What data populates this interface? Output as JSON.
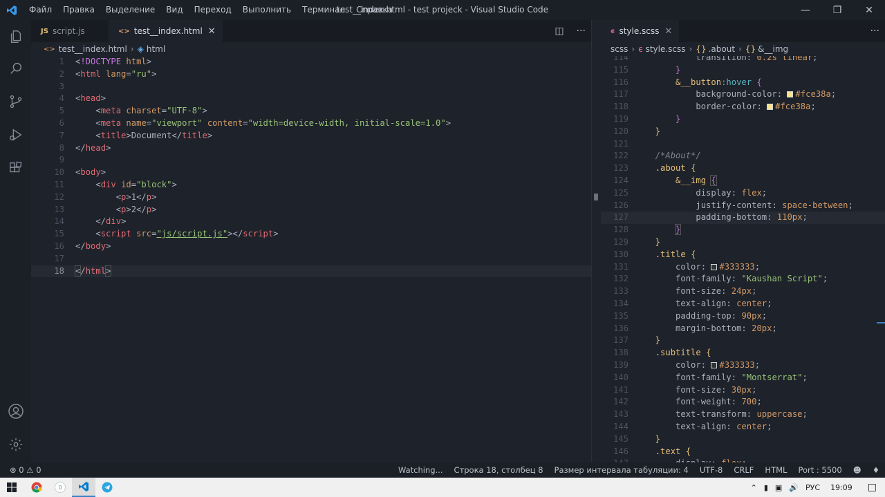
{
  "titlebar": {
    "menu": [
      "Файл",
      "Правка",
      "Выделение",
      "Вид",
      "Переход",
      "Выполнить",
      "Терминал",
      "Справка"
    ],
    "title": "test__index.html - test projeck - Visual Studio Code",
    "controls": [
      "minimize-icon",
      "restore-icon",
      "close-icon"
    ]
  },
  "activity": [
    "explorer-icon",
    "search-icon",
    "source-control-icon",
    "run-debug-icon",
    "extensions-icon",
    "account-icon",
    "settings-gear-icon"
  ],
  "left": {
    "tabs": [
      {
        "icon": "JS",
        "label": "script.js",
        "active": false
      },
      {
        "icon": "<>",
        "label": "test__index.html",
        "active": true
      }
    ],
    "breadcrumb": [
      "test__index.html",
      "html"
    ],
    "start_line": 1
  },
  "right": {
    "tabs": [
      {
        "icon": "scss",
        "label": "style.scss",
        "active": true
      }
    ],
    "breadcrumb": [
      "scss",
      "style.scss",
      ".about",
      "&__img"
    ]
  },
  "status": {
    "problems": "⊗ 0 ⚠ 0",
    "watching": "Watching...",
    "position": "Строка 18, столбец 8",
    "indent": "Размер интервала табуляции: 4",
    "encoding": "UTF-8",
    "eol": "CRLF",
    "language": "HTML",
    "port": "Port : 5500"
  },
  "tray": {
    "lang": "РУС",
    "time": "19:09"
  },
  "colors": {
    "accent": "#3b82c4",
    "swatch_yellow": "#fce38a",
    "swatch_dark": "#333333"
  }
}
